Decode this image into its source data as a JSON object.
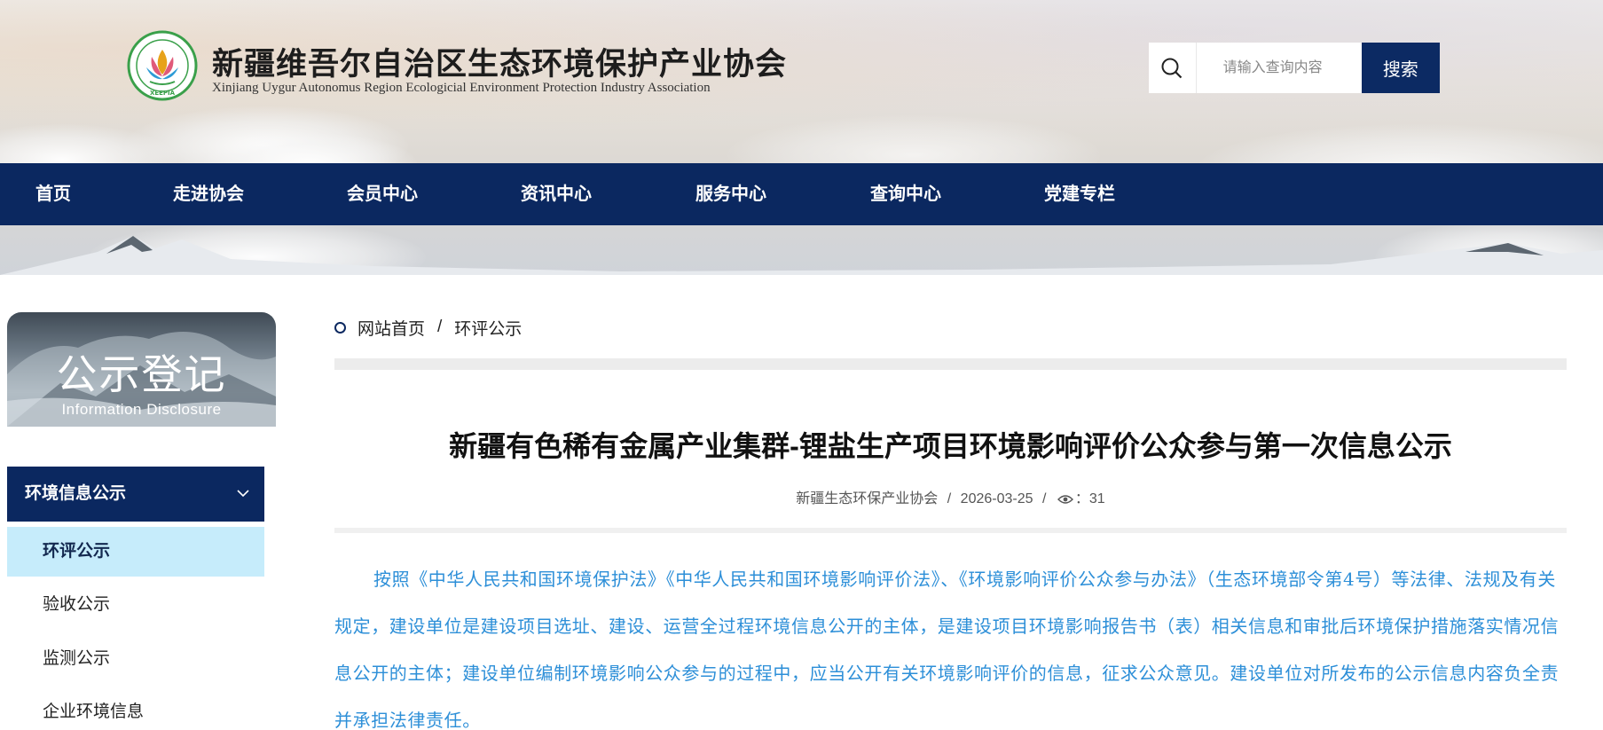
{
  "header": {
    "org_name": "新疆维吾尔自治区生态环境保护产业协会",
    "org_name_en": "Xinjiang Uygur Autonomus Region Ecologicial Environment Protection Industry Association",
    "logo_ring_text": "新疆维吾尔自治区生态环境保护产业协会",
    "logo_abbr": "XEEPIA",
    "search_placeholder": "请输入查询内容",
    "search_button": "搜索"
  },
  "nav": {
    "items": [
      "首页",
      "走进协会",
      "会员中心",
      "资讯中心",
      "服务中心",
      "查询中心",
      "党建专栏"
    ]
  },
  "sidebar": {
    "banner_title": "公示登记",
    "banner_subtitle": "Information Disclosure",
    "group_label": "环境信息公示",
    "items": [
      "环评公示",
      "验收公示",
      "监测公示",
      "企业环境信息"
    ],
    "active_index": 0
  },
  "breadcrumb": {
    "home": "网站首页",
    "separator": "/",
    "current": "环评公示"
  },
  "article": {
    "title": "新疆有色稀有金属产业集群-锂盐生产项目环境影响评价公众参与第一次信息公示",
    "source": "新疆生态环保产业协会",
    "date": "2026-03-25",
    "views": "31",
    "meta_sep": "/",
    "views_label_suffix": "：",
    "body": "按照《中华人民共和国环境保护法》《中华人民共和国环境影响评价法》、《环境影响评价公众参与办法》（生态环境部令第4号）等法律、法规及有关规定，建设单位是建设项目选址、建设、运营全过程环境信息公开的主体，是建设项目环境影响报告书（表）相关信息和审批后环境保护措施落实情况信息公开的主体；建设单位编制环境影响公众参与的过程中，应当公开有关环境影响评价的信息，征求公众意见。建设单位对所发布的公示信息内容负全责并承担法律责任。"
  },
  "colors": {
    "navy": "#0b2860",
    "active_side_bg": "#c6ecfb",
    "body_text": "#2d8fd8"
  }
}
